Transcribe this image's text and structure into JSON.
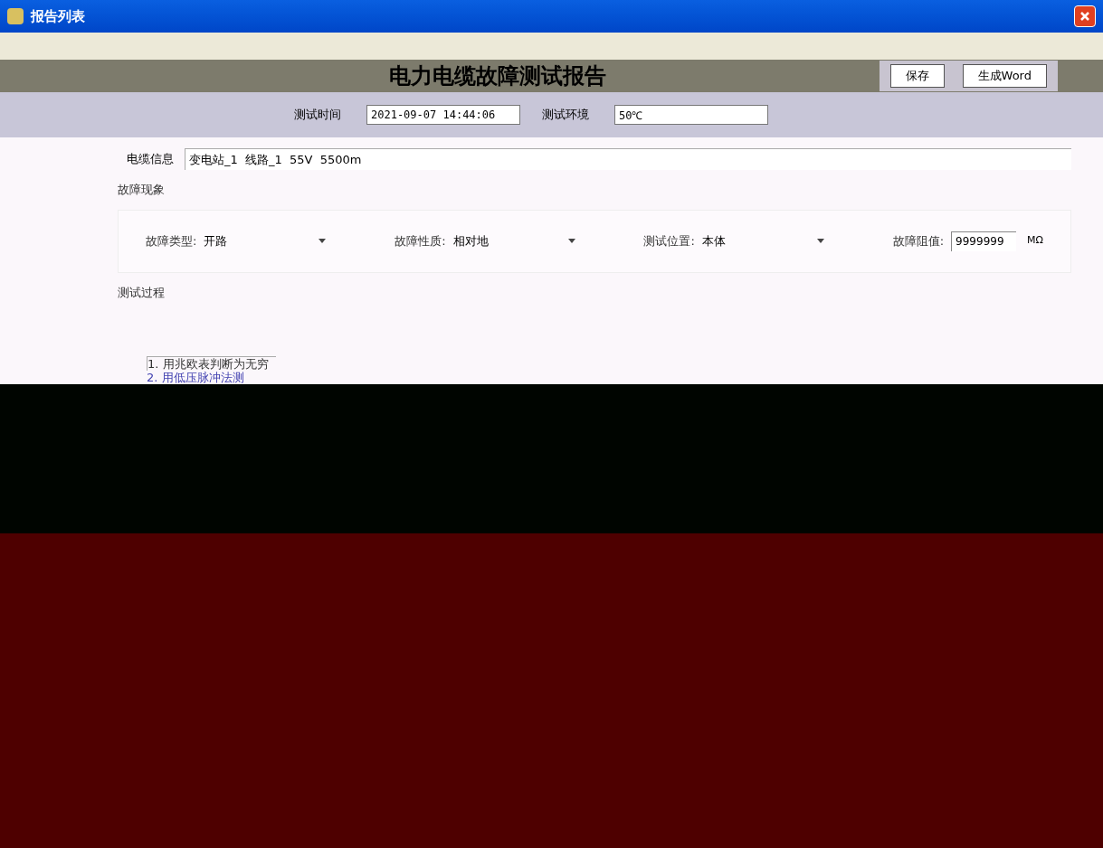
{
  "window": {
    "title": "报告列表"
  },
  "report": {
    "heading": "电力电缆故障测试报告",
    "buttons": [
      "保存",
      "生成Word"
    ]
  },
  "header_fields": [
    {
      "label": "测试时间",
      "value": "2021-09-07 14:44:06"
    },
    {
      "label": "测试环境",
      "value": "50℃"
    }
  ],
  "cable_info": {
    "label": "电缆信息",
    "value": "变电站_1  线路_1  55V  5500m"
  },
  "fault": {
    "title": "故障现象",
    "fields": [
      {
        "kind": "dropdown",
        "label": "故障类型:",
        "value": "开路"
      },
      {
        "kind": "dropdown",
        "label": "故障性质:",
        "value": "相对地"
      },
      {
        "kind": "dropdown",
        "label": "测试位置:",
        "value": "本体"
      },
      {
        "kind": "input",
        "label": "故障阻值:",
        "value": "9999999",
        "unit": "MΩ"
      }
    ]
  },
  "process": {
    "title": "测试过程",
    "lines": [
      "1. 用兆欧表判断为无穷",
      "2. 用低压脉冲法测"
    ]
  }
}
